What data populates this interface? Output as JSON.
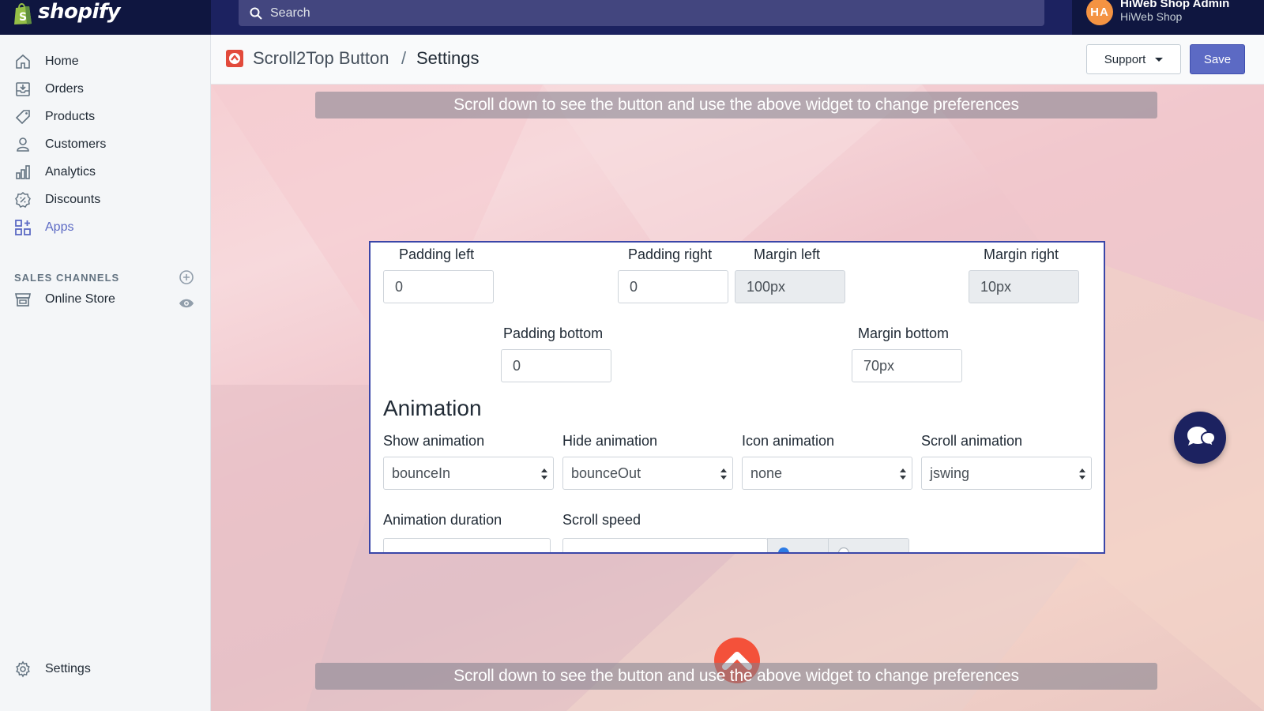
{
  "topbar": {
    "logo_text": "shopify",
    "search_placeholder": "Search",
    "avatar_initials": "HA",
    "user_name": "HiWeb Shop Admin",
    "user_shop": "HiWeb Shop"
  },
  "sidebar": {
    "items": [
      {
        "label": "Home",
        "icon": "home-icon"
      },
      {
        "label": "Orders",
        "icon": "orders-icon"
      },
      {
        "label": "Products",
        "icon": "tag-icon"
      },
      {
        "label": "Customers",
        "icon": "person-icon"
      },
      {
        "label": "Analytics",
        "icon": "bar-chart-icon"
      },
      {
        "label": "Discounts",
        "icon": "discount-icon"
      },
      {
        "label": "Apps",
        "icon": "apps-icon"
      }
    ],
    "sales_channels_label": "SALES CHANNELS",
    "online_store_label": "Online Store",
    "settings_label": "Settings"
  },
  "header": {
    "app_name": "Scroll2Top Button",
    "separator": "/",
    "page_title": "Settings",
    "support_label": "Support",
    "save_label": "Save"
  },
  "canvas": {
    "banner_text": "Scroll down to see the button and use the above widget to change preferences"
  },
  "form": {
    "padding_left_label": "Padding left",
    "padding_left_value": "0",
    "padding_right_label": "Padding right",
    "padding_right_value": "0",
    "margin_left_label": "Margin left",
    "margin_left_value": "100px",
    "margin_right_label": "Margin right",
    "margin_right_value": "10px",
    "padding_bottom_label": "Padding bottom",
    "padding_bottom_value": "0",
    "margin_bottom_label": "Margin bottom",
    "margin_bottom_value": "70px",
    "animation_heading": "Animation",
    "show_animation_label": "Show animation",
    "show_animation_value": "bounceIn",
    "hide_animation_label": "Hide animation",
    "hide_animation_value": "bounceOut",
    "icon_animation_label": "Icon animation",
    "icon_animation_value": "none",
    "scroll_animation_label": "Scroll animation",
    "scroll_animation_value": "jswing",
    "animation_duration_label": "Animation duration",
    "scroll_speed_label": "Scroll speed"
  },
  "colors": {
    "topbar": "#1c2260",
    "accent": "#5c6ac4",
    "scroll_button": "#f4513a",
    "panel_border": "#3a46a8"
  }
}
